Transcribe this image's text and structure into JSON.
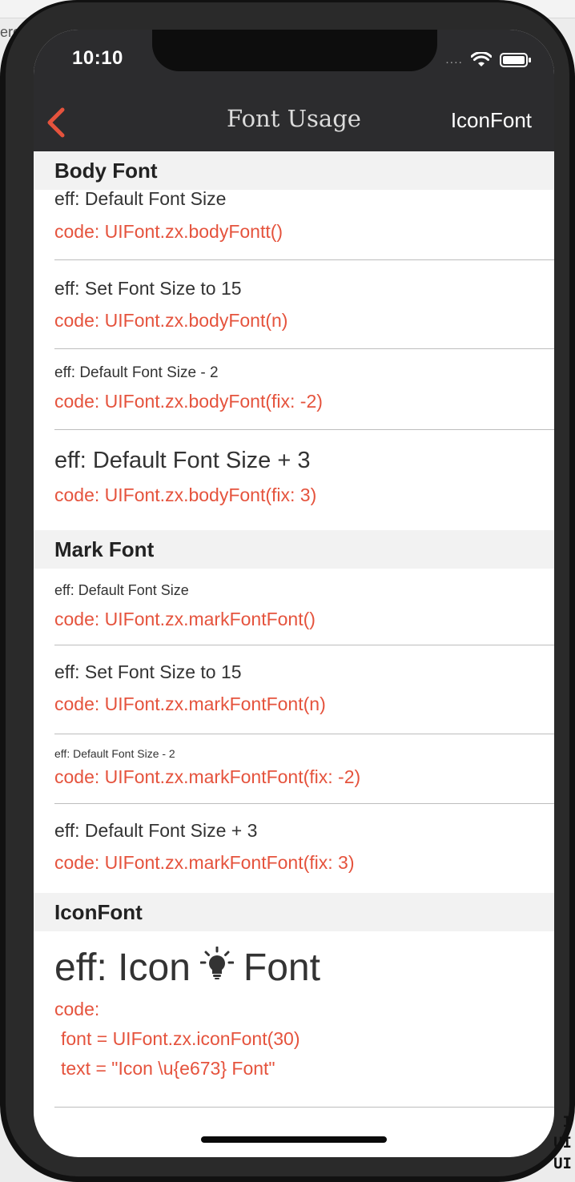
{
  "desktop": {
    "fragment_text": "ero",
    "code_lines": [
      "I",
      "UI",
      "UI"
    ]
  },
  "status_bar": {
    "time": "10:10",
    "signal": "....",
    "wifi_icon": "wifi-icon",
    "battery_icon": "battery-icon"
  },
  "nav": {
    "back_icon": "chevron-left-icon",
    "title": "Font Usage",
    "right_button": "IconFont",
    "accent_color": "#e5533d",
    "bar_color": "#2c2c2e"
  },
  "sections": {
    "body": {
      "title": "Body Font",
      "rows": [
        {
          "eff": "eff: Default Font Size",
          "code": "code: UIFont.zx.bodyFontt()"
        },
        {
          "eff": "eff: Set Font Size to 15",
          "code": "code: UIFont.zx.bodyFont(n)"
        },
        {
          "eff": "eff: Default Font Size - 2",
          "code": "code: UIFont.zx.bodyFont(fix: -2)"
        },
        {
          "eff": "eff: Default Font Size + 3",
          "code": "code: UIFont.zx.bodyFont(fix: 3)"
        }
      ]
    },
    "mark": {
      "title": "Mark Font",
      "rows": [
        {
          "eff": "eff: Default Font Size",
          "code": "code: UIFont.zx.markFontFont()"
        },
        {
          "eff": "eff: Set Font Size to 15",
          "code": "code: UIFont.zx.markFontFont(n)"
        },
        {
          "eff": "eff: Default Font Size - 2",
          "code": "code: UIFont.zx.markFontFont(fix: -2)"
        },
        {
          "eff": "eff: Default Font Size + 3",
          "code": "code: UIFont.zx.markFontFont(fix: 3)"
        }
      ]
    },
    "icon": {
      "title": "IconFont",
      "eff_prefix": "eff: Icon",
      "eff_suffix": "Font",
      "glyph_icon": "lightbulb-icon",
      "code_label": "code:",
      "code_line1": "font = UIFont.zx.iconFont(30)",
      "code_line2": "text = \"Icon \\u{e673} Font\""
    }
  }
}
